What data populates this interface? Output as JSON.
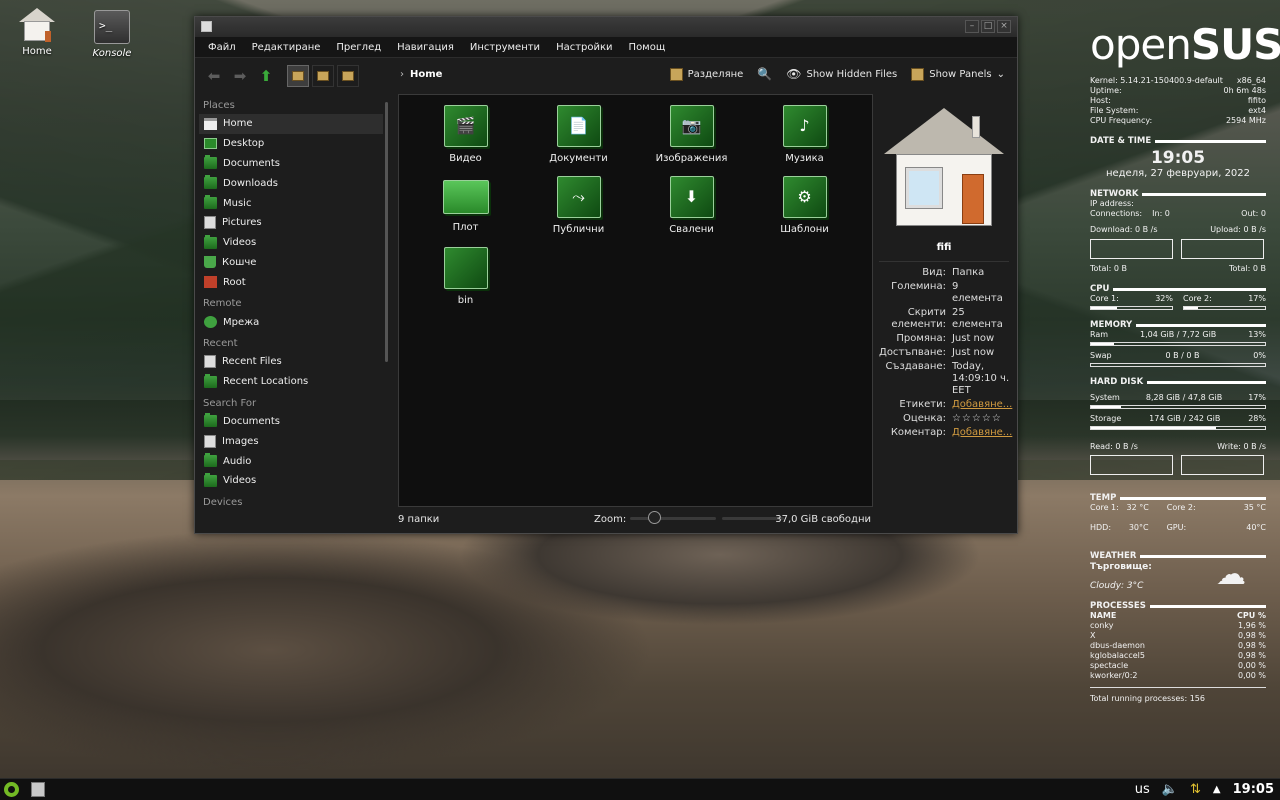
{
  "desktop": {
    "icons": [
      {
        "label": "Home"
      },
      {
        "label": "Konsole"
      }
    ]
  },
  "window": {
    "menu": [
      "Файл",
      "Редактиране",
      "Преглед",
      "Навигация",
      "Инструменти",
      "Настройки",
      "Помощ"
    ],
    "breadcrumb": "Home",
    "toolbar": {
      "split": "Разделяне",
      "show_hidden": "Show Hidden Files",
      "show_panels": "Show Panels"
    },
    "sidebar": {
      "places_label": "Places",
      "places": [
        "Home",
        "Desktop",
        "Documents",
        "Downloads",
        "Music",
        "Pictures",
        "Videos",
        "Кошче",
        "Root"
      ],
      "remote_label": "Remote",
      "remote": [
        "Мрежа"
      ],
      "recent_label": "Recent",
      "recent": [
        "Recent Files",
        "Recent Locations"
      ],
      "search_label": "Search For",
      "search": [
        "Documents",
        "Images",
        "Audio",
        "Videos"
      ],
      "devices_label": "Devices"
    },
    "files": [
      {
        "name": "Видео",
        "icon": "video-folder-icon"
      },
      {
        "name": "Документи",
        "icon": "documents-folder-icon"
      },
      {
        "name": "Изображения",
        "icon": "pictures-folder-icon"
      },
      {
        "name": "Музика",
        "icon": "music-folder-icon"
      },
      {
        "name": "Плот",
        "icon": "desktop-folder-icon"
      },
      {
        "name": "Публични",
        "icon": "public-folder-icon"
      },
      {
        "name": "Свалени",
        "icon": "downloads-folder-icon"
      },
      {
        "name": "Шаблони",
        "icon": "templates-folder-icon"
      },
      {
        "name": "bin",
        "icon": "folder-icon"
      }
    ],
    "status": {
      "count": "9 папки",
      "zoom_label": "Zoom:",
      "free": "37,0 GiB свободни"
    },
    "info": {
      "name": "fifi",
      "rows": [
        {
          "k": "Вид:",
          "v": "Папка"
        },
        {
          "k": "Големина:",
          "v": "9 елемента"
        },
        {
          "k": "Скрити елементи:",
          "v": "25 елемента"
        },
        {
          "k": "Промяна:",
          "v": "Just now"
        },
        {
          "k": "Достъпване:",
          "v": "Just now"
        },
        {
          "k": "Създаване:",
          "v": "Today, 14:09:10 ч. EET"
        }
      ],
      "tags_label": "Етикети:",
      "tags_link": "Добавяне...",
      "rating_label": "Оценка:",
      "rating": "☆☆☆☆☆",
      "comment_label": "Коментар:",
      "comment_link": "Добавяне..."
    }
  },
  "conky": {
    "logo_a": "open",
    "logo_b": "SUSE",
    "sys": [
      {
        "k": "Kernel:",
        "v": "5.14.21-150400.9-default",
        "v2": "x86_64"
      },
      {
        "k": "Uptime:",
        "v": "",
        "v2": "0h 6m 48s"
      },
      {
        "k": "Host:",
        "v": "",
        "v2": "fifito"
      },
      {
        "k": "File System:",
        "v": "",
        "v2": "ext4"
      },
      {
        "k": "CPU Frequency:",
        "v": "",
        "v2": "2594 MHz"
      }
    ],
    "datetime_h": "DATE & TIME",
    "time": "19:05",
    "date": "неделя, 27 февруари, 2022",
    "network_h": "NETWORK",
    "ip": "IP address:",
    "conn": "Connections:",
    "conn_in": "In: 0",
    "conn_out": "Out: 0",
    "download": "Download: 0 B",
    "upload": "Upload: 0 B",
    "per_s": "/s",
    "total_l": "Total: 0 B",
    "total_r": "Total: 0 B",
    "cpu_h": "CPU",
    "core1": "Core 1:",
    "core1_v": "32%",
    "core1_pct": 0.32,
    "core2": "Core 2:",
    "core2_v": "17%",
    "core2_pct": 0.17,
    "mem_h": "MEMORY",
    "ram": "Ram",
    "ram_v": "1,04 GiB / 7,72 GiB",
    "ram_p": "13%",
    "ram_pct": 0.13,
    "swap": "Swap",
    "swap_v": "0 B   / 0 B",
    "swap_p": "0%",
    "swap_pct": 0,
    "disk_h": "HARD DISK",
    "system": "System",
    "system_v": "8,28 GiB / 47,8 GiB",
    "system_p": "17%",
    "system_pct": 0.17,
    "storage": "Storage",
    "storage_v": "174 GiB  / 242 GiB",
    "storage_p": "28%",
    "storage_pct": 0.72,
    "read": "Read: 0 B",
    "write": "Write: 0 B",
    "temp_h": "TEMP",
    "t_core1": "Core 1:",
    "t_core1_v": "32 °C",
    "t_core2": "Core 2:",
    "t_core2_v": "35 °C",
    "hdd": "HDD:",
    "hdd_v": "30°C",
    "gpu": "GPU:",
    "gpu_v": "40°C",
    "weather_h": "WEATHER",
    "city": "Търговище:",
    "cond": "Cloudy: 3°C",
    "proc_h": "PROCESSES",
    "proc_name": "NAME",
    "proc_cpu": "CPU %",
    "procs": [
      {
        "n": "conky",
        "c": "1,96 %"
      },
      {
        "n": "X",
        "c": "0,98 %"
      },
      {
        "n": "dbus-daemon",
        "c": "0,98 %"
      },
      {
        "n": "kglobalaccel5",
        "c": "0,98 %"
      },
      {
        "n": "spectacle",
        "c": "0,00 %"
      },
      {
        "n": "kworker/0:2",
        "c": "0,00 %"
      }
    ],
    "total_procs": "Total running processes: 156"
  },
  "taskbar": {
    "layout": "us",
    "clock": "19:05"
  }
}
